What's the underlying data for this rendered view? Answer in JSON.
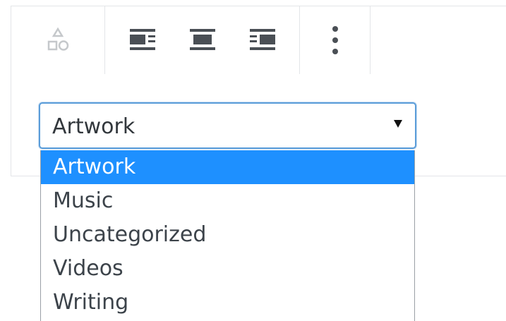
{
  "toolbar": {
    "groups": [
      {
        "buttons": [
          {
            "icon": "block-type-shapes-icon"
          }
        ]
      },
      {
        "buttons": [
          {
            "icon": "align-left-icon"
          },
          {
            "icon": "align-center-icon"
          },
          {
            "icon": "align-right-icon"
          }
        ]
      },
      {
        "buttons": [
          {
            "icon": "more-options-icon"
          }
        ]
      }
    ]
  },
  "select": {
    "value": "Artwork",
    "options": [
      "Artwork",
      "Music",
      "Uncategorized",
      "Videos",
      "Writing"
    ],
    "selected_index": 0
  },
  "colors": {
    "selected_bg": "#1e90ff",
    "focus_border": "#5b9dd9",
    "text": "#32373c"
  }
}
